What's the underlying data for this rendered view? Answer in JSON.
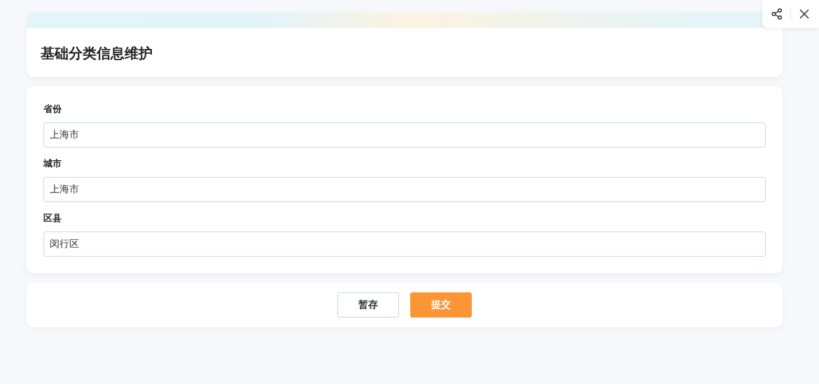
{
  "header": {
    "title": "基础分类信息维护"
  },
  "fields": [
    {
      "label": "省份",
      "value": "上海市"
    },
    {
      "label": "城市",
      "value": "上海市"
    },
    {
      "label": "区县",
      "value": "闵行区"
    }
  ],
  "buttons": [
    {
      "label": "暂存",
      "kind": "secondary"
    },
    {
      "label": "提交",
      "kind": "primary"
    }
  ]
}
